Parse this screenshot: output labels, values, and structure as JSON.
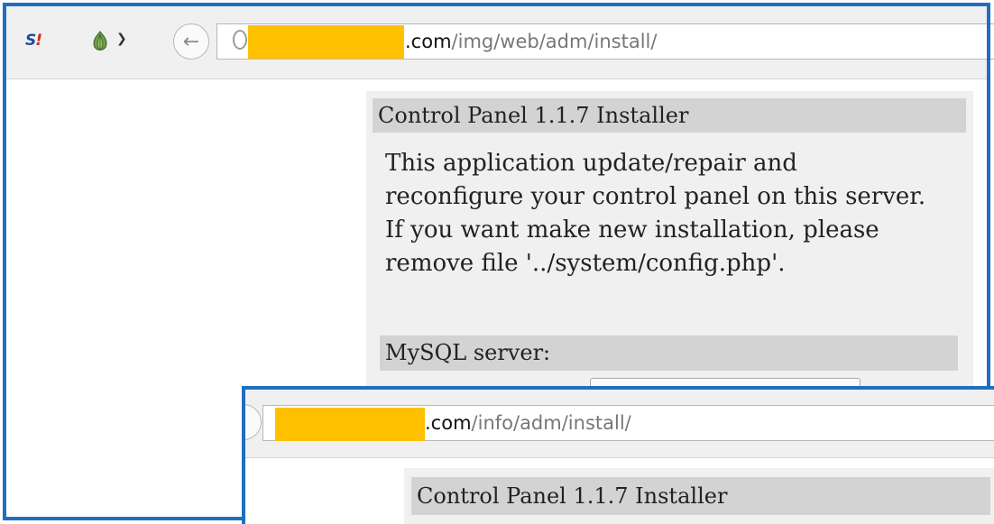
{
  "browser1": {
    "url_domain": ".com",
    "url_path": "/img/web/adm/install/"
  },
  "browser2": {
    "url_domain": ".com",
    "url_path": "/info/adm/install/"
  },
  "panel1": {
    "title": "Control Panel 1.1.7 Installer",
    "description": "This application update/repair and reconfigure your control panel on this server. If you want make new installation, please remove file '../system/config.php'.",
    "section_mysql": "MySQL server:"
  },
  "panel2": {
    "title": "Control Panel 1.1.7 Installer"
  },
  "icons": {
    "addon1": "stumbleupon-icon",
    "addon2": "onion-icon",
    "menu": "chevron-down-icon",
    "back": "back-arrow-icon",
    "site_identity": "globe-icon"
  },
  "colors": {
    "frame": "#1f6fbf",
    "redaction": "#ffc000",
    "panel_bg": "#f0f0f0",
    "header_bg": "#d3d3d3"
  }
}
